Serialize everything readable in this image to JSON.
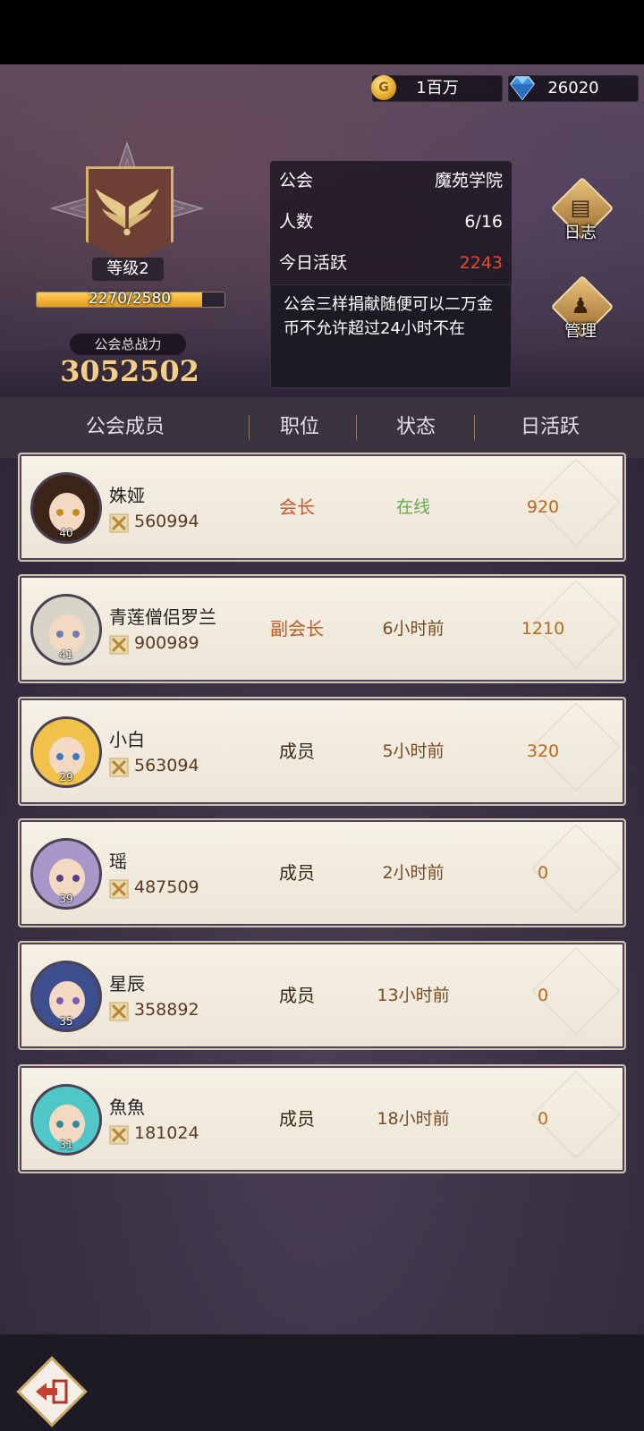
{
  "currency": {
    "gold": "1百万",
    "gems": "26020"
  },
  "emblem": {
    "level_label": "等级2",
    "xp_text": "2270/2580",
    "xp_fraction": 0.88,
    "power_label": "公会总战力",
    "power_value": "3052502"
  },
  "info": {
    "guild_label": "公会",
    "guild_name": "魔苑学院",
    "members_label": "人数",
    "members_value": "6/16",
    "active_label": "今日活跃",
    "active_value": "2243",
    "notice": "公会三样捐献随便可以二万金币不允许超过24小时不在"
  },
  "side": {
    "log_label": "日志",
    "manage_label": "管理"
  },
  "header": {
    "member": "公会成员",
    "role": "职位",
    "status": "状态",
    "active": "日活跃"
  },
  "members": [
    {
      "name": "姝娅",
      "power": "560994",
      "level": "40",
      "role": "会长",
      "status": "在线",
      "active": "920",
      "hair": "#3b2418",
      "eye": "#c9891f"
    },
    {
      "name": "青莲僧侣罗兰",
      "power": "900989",
      "level": "41",
      "role": "副会长",
      "status": "6小时前",
      "active": "1210",
      "hair": "#d9d4c8",
      "eye": "#6a7fb0"
    },
    {
      "name": "小白",
      "power": "563094",
      "level": "29",
      "role": "成员",
      "status": "5小时前",
      "active": "320",
      "hair": "#f1c24a",
      "eye": "#3d78c9"
    },
    {
      "name": "瑶",
      "power": "487509",
      "level": "39",
      "role": "成员",
      "status": "2小时前",
      "active": "0",
      "hair": "#a897c8",
      "eye": "#5a3a8a"
    },
    {
      "name": "星辰",
      "power": "358892",
      "level": "35",
      "role": "成员",
      "status": "13小时前",
      "active": "0",
      "hair": "#3d4f8f",
      "eye": "#7a5ab8"
    },
    {
      "name": "魚魚",
      "power": "181024",
      "level": "31",
      "role": "成员",
      "status": "18小时前",
      "active": "0",
      "hair": "#4fc7c9",
      "eye": "#2f8a9c"
    }
  ],
  "colors": {
    "leader": "#d0552a",
    "vice": "#c05a1e",
    "member": "#3a2a1a",
    "online": "#6aa84f"
  }
}
